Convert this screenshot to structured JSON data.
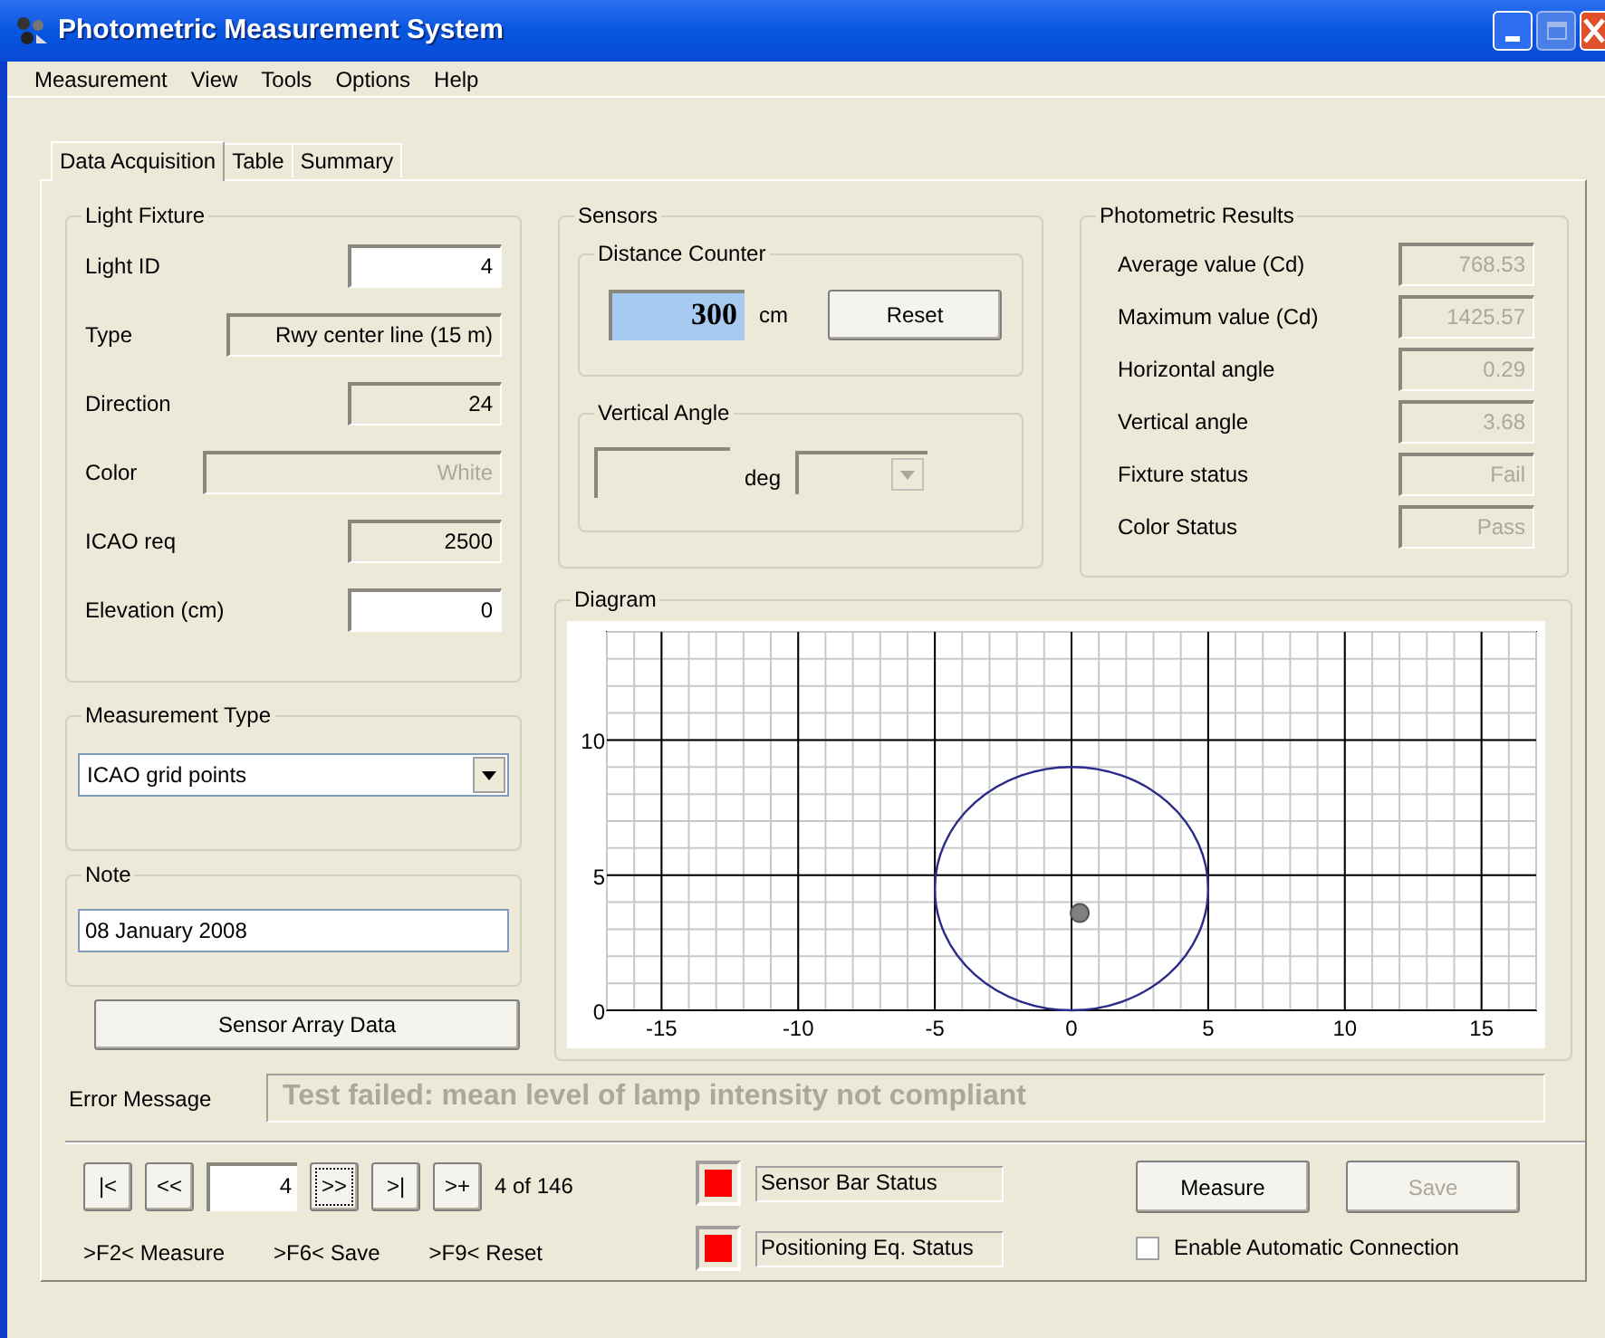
{
  "window": {
    "title": "Photometric Measurement System"
  },
  "menu": [
    "Measurement",
    "View",
    "Tools",
    "Options",
    "Help"
  ],
  "tabs": [
    {
      "label": "Data Acquisition",
      "selected": true
    },
    {
      "label": "Table",
      "selected": false
    },
    {
      "label": "Summary",
      "selected": false
    }
  ],
  "light_fixture": {
    "title": "Light Fixture",
    "fields": [
      {
        "label": "Light ID",
        "value": "4",
        "kind": "editable",
        "wide": false
      },
      {
        "label": "Type",
        "value": "Rwy center line (15 m)",
        "kind": "readonly",
        "wide": true
      },
      {
        "label": "Direction",
        "value": "24",
        "kind": "readonly",
        "wide": false
      },
      {
        "label": "Color",
        "value": "White",
        "kind": "disabled",
        "wide": true
      },
      {
        "label": "ICAO req",
        "value": "2500",
        "kind": "readonly",
        "wide": false
      },
      {
        "label": "Elevation (cm)",
        "value": "0",
        "kind": "editable",
        "wide": false
      }
    ]
  },
  "sensors": {
    "title": "Sensors",
    "distance_counter": {
      "title": "Distance Counter",
      "value": "300",
      "unit": "cm",
      "button": "Reset"
    },
    "vertical_angle": {
      "title": "Vertical Angle",
      "unit": "deg",
      "dropdown_disabled": true
    }
  },
  "photometric_results": {
    "title": "Photometric Results",
    "fields": [
      {
        "label": "Average value (Cd)",
        "value": "768.53",
        "kind": "disabled"
      },
      {
        "label": "Maximum value (Cd)",
        "value": "1425.57",
        "kind": "disabled"
      },
      {
        "label": "Horizontal angle",
        "value": "0.29",
        "kind": "disabled"
      },
      {
        "label": "Vertical angle",
        "value": "3.68",
        "kind": "disabled"
      },
      {
        "label": "Fixture status",
        "value": "Fail",
        "kind": "disabled"
      },
      {
        "label": "Color Status",
        "value": "Pass",
        "kind": "disabled"
      }
    ]
  },
  "measurement_type": {
    "title": "Measurement Type",
    "value": "ICAO grid points"
  },
  "note": {
    "title": "Note",
    "value": "08 January 2008"
  },
  "sensor_array_button": "Sensor Array Data",
  "diagram": {
    "title": "Diagram",
    "chart_data": {
      "type": "scatter",
      "xlim": [
        -17,
        17
      ],
      "ylim": [
        0,
        14
      ],
      "xticks": [
        -15,
        -10,
        -5,
        0,
        5,
        10,
        15
      ],
      "yticks": [
        0,
        5,
        10
      ],
      "grid": true,
      "x": [
        0.3
      ],
      "series": [
        {
          "color": "#808080",
          "values": [
            3.6
          ]
        }
      ]
    }
  },
  "error": {
    "label": "Error Message",
    "value": "Test failed: mean level of lamp intensity not compliant"
  },
  "navigation": {
    "buttons": [
      {
        "label": "|<",
        "focused": false
      },
      {
        "label": "<<",
        "focused": false
      }
    ],
    "record": "4",
    "after": [
      {
        "label": ">>",
        "focused": true
      },
      {
        "label": ">|",
        "focused": false
      },
      {
        "label": ">+",
        "focused": false
      }
    ],
    "count": "4 of 146"
  },
  "shortcuts": [
    ">F2< Measure",
    ">F6< Save",
    ">F9< Reset"
  ],
  "statuses": [
    {
      "label": "Sensor Bar Status",
      "color": "#ff0000"
    },
    {
      "label": "Positioning Eq. Status",
      "color": "#ff0000"
    }
  ],
  "actions": [
    {
      "label": "Measure",
      "disabled": false
    },
    {
      "label": "Save",
      "disabled": true
    }
  ],
  "auto_connect": {
    "label": "Enable Automatic Connection",
    "checked": false
  }
}
